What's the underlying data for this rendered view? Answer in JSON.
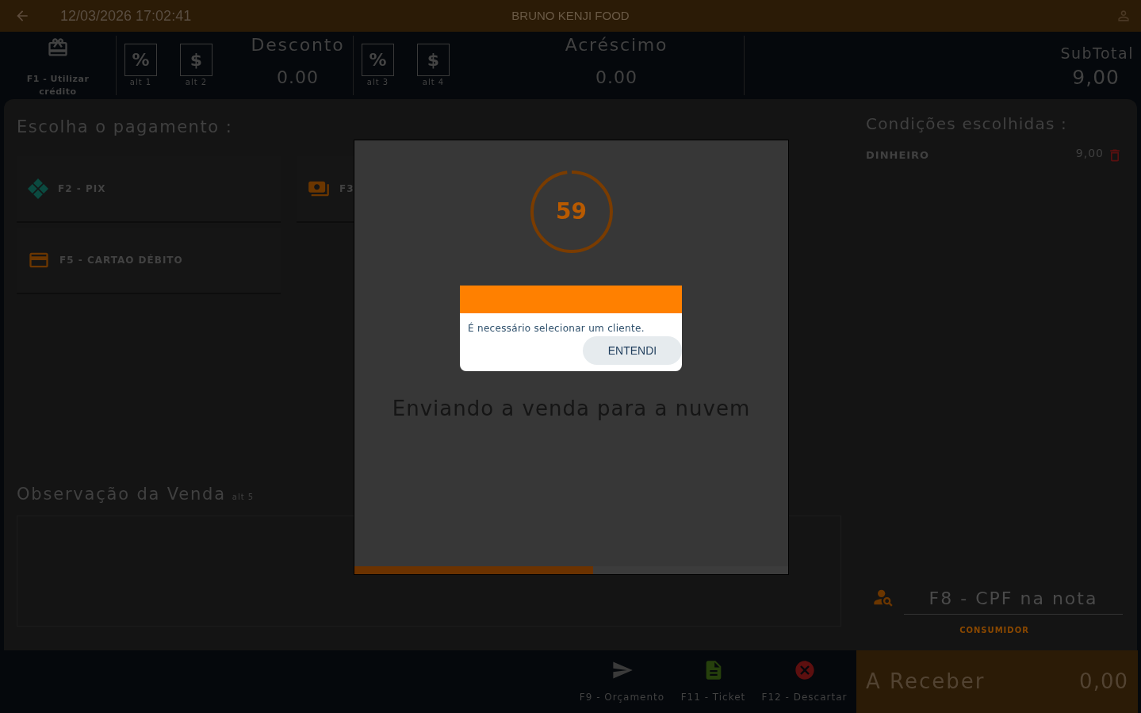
{
  "top_bar": {
    "datetime": "12/03/2026 17:02:41",
    "title": "BRUNO KENJI FOOD"
  },
  "header": {
    "credit": {
      "label": "F1 - Utilizar crédito"
    },
    "discount": {
      "title": "Desconto",
      "value": "0.00",
      "buttons": [
        {
          "symbol": "%",
          "shortcut": "alt 1"
        },
        {
          "symbol": "$",
          "shortcut": "alt 2"
        }
      ]
    },
    "surcharge": {
      "title": "Acréscimo",
      "value": "0.00",
      "buttons": [
        {
          "symbol": "%",
          "shortcut": "alt 3"
        },
        {
          "symbol": "$",
          "shortcut": "alt 4"
        }
      ]
    },
    "subtotal": {
      "label": "SubTotal",
      "value": "9,00"
    }
  },
  "payment": {
    "title": "Escolha o pagamento :",
    "methods": [
      {
        "kind": "pix",
        "label": "F2 - PIX"
      },
      {
        "kind": "cash",
        "label": "F3"
      },
      {
        "kind": "card",
        "label": "F5 - CARTAO DÉBITO"
      }
    ]
  },
  "notes": {
    "title": "Observação da Venda",
    "shortcut": "alt 5"
  },
  "conditions": {
    "title": "Condições escolhidas :",
    "items": [
      {
        "name": "DINHEIRO",
        "amount": "9,00"
      }
    ]
  },
  "customer": {
    "placeholder": "F8 - CPF na nota",
    "name": "CONSUMIDOR"
  },
  "actions": [
    {
      "kind": "send",
      "label": "F9 - Orçamento"
    },
    {
      "kind": "ticket",
      "label": "F11 - Ticket"
    },
    {
      "kind": "discard",
      "label": "F12 - Descartar"
    }
  ],
  "receivable": {
    "label": "A Receber",
    "value": "0,00"
  },
  "sending_dialog": {
    "countdown": "59",
    "level": 0.98,
    "message": "Enviando a venda para a nuvem",
    "progress": {
      "level": 0.55
    }
  },
  "alert": {
    "message": "É necessário selecionar um cliente.",
    "button": "ENTENDI"
  }
}
